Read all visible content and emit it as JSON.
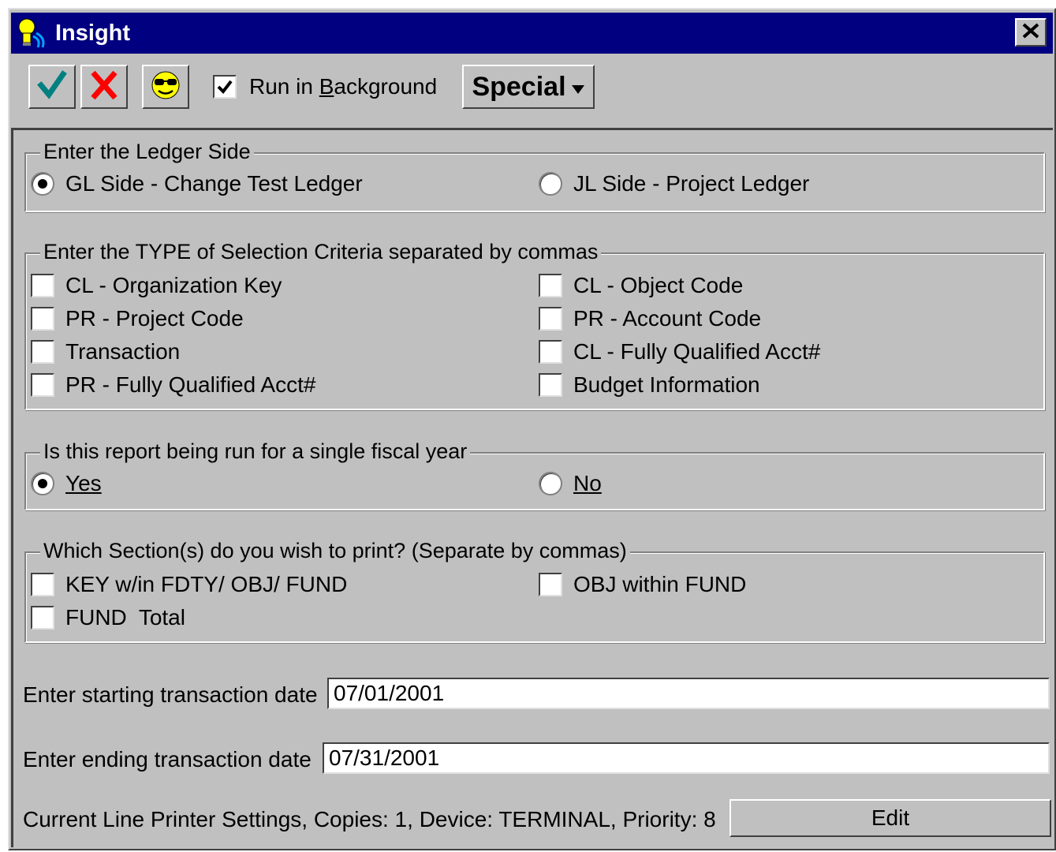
{
  "window": {
    "title": "Insight",
    "close_glyph": "✕"
  },
  "toolbar": {
    "ok_icon": "checkmark-icon",
    "cancel_icon": "red-x-icon",
    "sunglasses_icon": "sunglasses-smiley-icon",
    "run_in_background_label_pre": "Run in ",
    "run_in_background_label_u": "B",
    "run_in_background_label_post": "ackground",
    "run_in_background_checked": true,
    "special_label": "Special",
    "special_arrow": "▾"
  },
  "ledger_side": {
    "legend": "Enter the Ledger Side",
    "options": [
      {
        "label": "GL Side - Change Test Ledger",
        "selected": true
      },
      {
        "label": "JL Side - Project Ledger",
        "selected": false
      }
    ]
  },
  "selection_criteria": {
    "legend": "Enter the TYPE of Selection Criteria separated by commas",
    "items": [
      {
        "label": "CL - Organization Key",
        "checked": false
      },
      {
        "label": "CL - Object Code",
        "checked": false
      },
      {
        "label": "PR - Project Code",
        "checked": false
      },
      {
        "label": "PR - Account Code",
        "checked": false
      },
      {
        "label": "Transaction",
        "checked": false
      },
      {
        "label": "CL - Fully Qualified Acct#",
        "checked": false
      },
      {
        "label": "PR - Fully Qualified Acct#",
        "checked": false
      },
      {
        "label": "Budget Information",
        "checked": false
      }
    ]
  },
  "fiscal_year": {
    "legend": "Is this report being run for a single fiscal year",
    "options": [
      {
        "label": "Yes",
        "selected": true
      },
      {
        "label": "No",
        "selected": false
      }
    ]
  },
  "sections": {
    "legend": "Which Section(s) do you wish to print? (Separate by commas)",
    "items": [
      {
        "label": "KEY w/in FDTY/ OBJ/ FUND",
        "checked": false
      },
      {
        "label": "OBJ within FUND",
        "checked": false
      },
      {
        "label": "FUND  Total",
        "checked": false
      }
    ]
  },
  "dates": {
    "start_label": "Enter starting transaction date",
    "start_value": "07/01/2001",
    "end_label": "Enter ending transaction date",
    "end_value": "07/31/2001"
  },
  "printer": {
    "settings_text": "Current Line Printer Settings, Copies: 1, Device: TERMINAL, Priority: 8",
    "edit_label": "Edit"
  },
  "colors": {
    "titlebar": "#000080",
    "face": "#c0c0c0",
    "ok_check": "#008080",
    "cancel_x": "#ff0000",
    "smiley": "#ffff00"
  }
}
